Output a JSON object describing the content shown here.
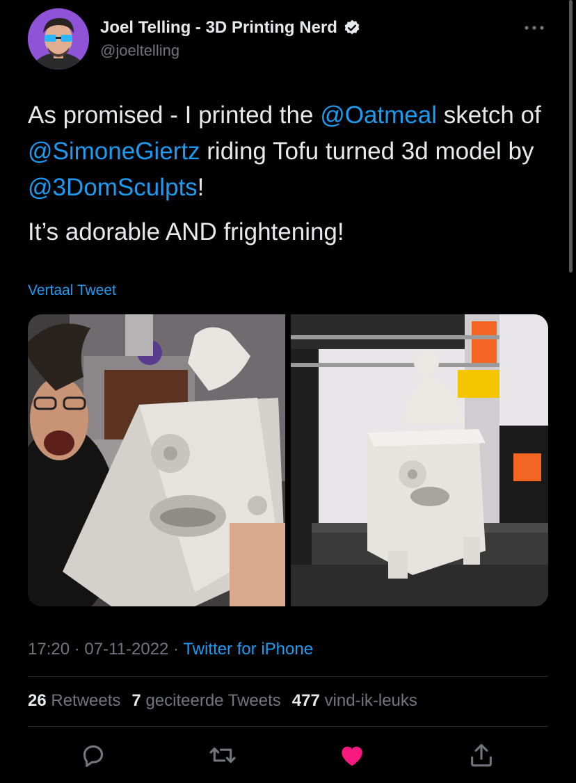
{
  "author": {
    "display_name": "Joel Telling - 3D Printing Nerd",
    "handle": "@joeltelling",
    "verified": true
  },
  "tweet": {
    "segments_line1": [
      {
        "t": "As promised - I printed the ",
        "mention": false
      },
      {
        "t": "@Oatmeal",
        "mention": true
      },
      {
        "t": " sketch of ",
        "mention": false
      },
      {
        "t": "@SimoneGiertz",
        "mention": true
      },
      {
        "t": " riding Tofu turned 3d model by ",
        "mention": false
      },
      {
        "t": "@3DomSculpts",
        "mention": true
      },
      {
        "t": "!",
        "mention": false
      }
    ],
    "paragraph2": "It’s adorable AND frightening!",
    "translate_label": "Vertaal Tweet"
  },
  "media": {
    "photo1_alt": "Selfie holding 3D printed white figure",
    "photo2_alt": "White 3D printed figure on printer bed"
  },
  "meta": {
    "time": "17:20",
    "date": "07-11-2022",
    "separator": "·",
    "source": "Twitter for iPhone"
  },
  "stats": {
    "retweets_count": "26",
    "retweets_label": "Retweets",
    "quotes_count": "7",
    "quotes_label": "geciteerde Tweets",
    "likes_count": "477",
    "likes_label": "vind-ik-leuks"
  },
  "actions": {
    "reply_icon": "reply-icon",
    "retweet_icon": "retweet-icon",
    "like_icon": "heart-icon",
    "share_icon": "share-icon"
  },
  "colors": {
    "accent": "#1d9bf0",
    "like": "#f91880",
    "muted": "#71767b",
    "background": "#000000"
  }
}
